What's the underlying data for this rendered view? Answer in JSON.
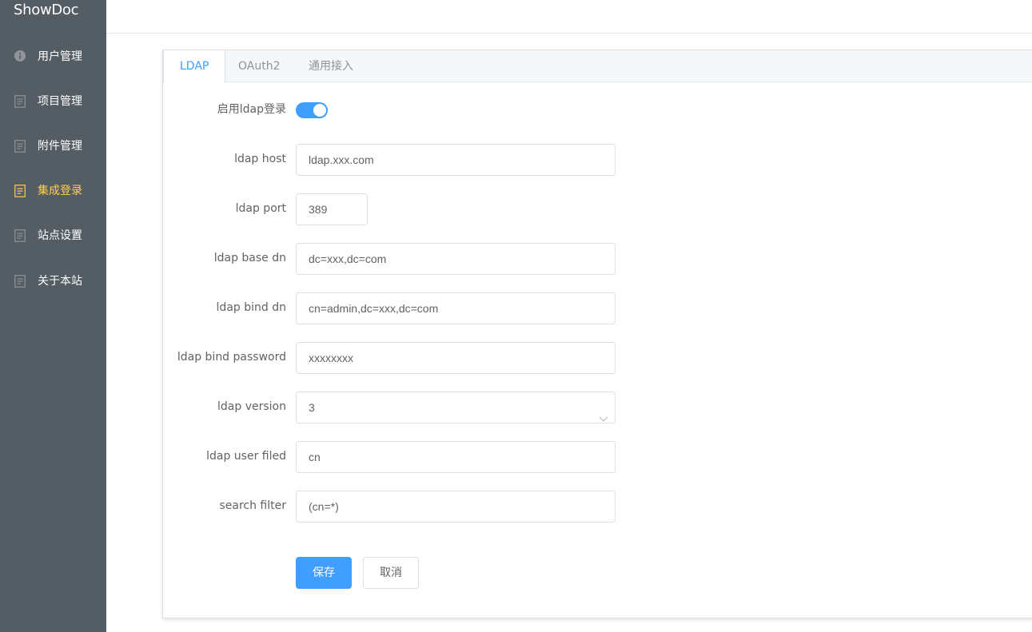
{
  "app": {
    "logo": "ShowDoc"
  },
  "sidebar": {
    "items": [
      {
        "label": "用户管理",
        "icon": "info-icon",
        "active": false
      },
      {
        "label": "项目管理",
        "icon": "document-icon",
        "active": false
      },
      {
        "label": "附件管理",
        "icon": "document-icon",
        "active": false
      },
      {
        "label": "集成登录",
        "icon": "document-icon",
        "active": true
      },
      {
        "label": "站点设置",
        "icon": "document-icon",
        "active": false
      },
      {
        "label": "关于本站",
        "icon": "document-icon",
        "active": false
      }
    ]
  },
  "tabs": [
    {
      "label": "LDAP",
      "active": true
    },
    {
      "label": "OAuth2",
      "active": false
    },
    {
      "label": "通用接入",
      "active": false
    }
  ],
  "form": {
    "enable_label": "启用ldap登录",
    "enable_value": true,
    "host_label": "ldap host",
    "host_value": "ldap.xxx.com",
    "port_label": "ldap port",
    "port_value": "389",
    "base_dn_label": "ldap base dn",
    "base_dn_value": "dc=xxx,dc=com",
    "bind_dn_label": "ldap bind dn",
    "bind_dn_value": "cn=admin,dc=xxx,dc=com",
    "bind_password_label": "ldap bind password",
    "bind_password_value": "xxxxxxxx",
    "version_label": "ldap version",
    "version_value": "3",
    "user_field_label": "ldap user filed",
    "user_field_value": "cn",
    "search_filter_label": "search filter",
    "search_filter_value": "(cn=*)"
  },
  "actions": {
    "save_label": "保存",
    "cancel_label": "取消"
  },
  "colors": {
    "sidebar_bg": "#545c64",
    "active_menu": "#ffd04b",
    "accent": "#409eff"
  }
}
